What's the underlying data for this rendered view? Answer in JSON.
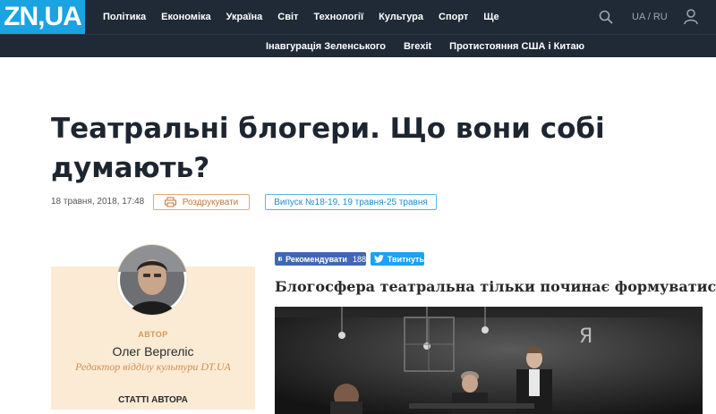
{
  "header": {
    "logo": "ZN,UA",
    "nav": [
      "Політика",
      "Економіка",
      "Україна",
      "Світ",
      "Технології",
      "Культура",
      "Спорт",
      "Ще"
    ],
    "lang": "UA / RU",
    "subnav": [
      "Інавгурація Зеленського",
      "Brexit",
      "Протистояння США і Китаю"
    ],
    "colors": {
      "bar": "#1f2a36",
      "logo": "#1aa3e0"
    }
  },
  "article": {
    "title": "Театральні блогери. Що вони собі думають?",
    "date": "18 травня, 2018, 17:48",
    "print_label": "Роздрукувати",
    "issue_label": "Випуск №18-19, 19 травня-25 травня",
    "lead": "Блогосфера театральна тільки починає формуватися."
  },
  "author": {
    "role": "АВТОР",
    "name": "Олег Вергеліс",
    "position": "Редактор відділу культури DT.UA",
    "articles_label": "СТАТТІ АВТОРА"
  },
  "social": {
    "fb_label": "Рекомендувати",
    "fb_count": "188",
    "tw_label": "Твитнуть"
  },
  "photo": {
    "sign_text": "Я"
  }
}
